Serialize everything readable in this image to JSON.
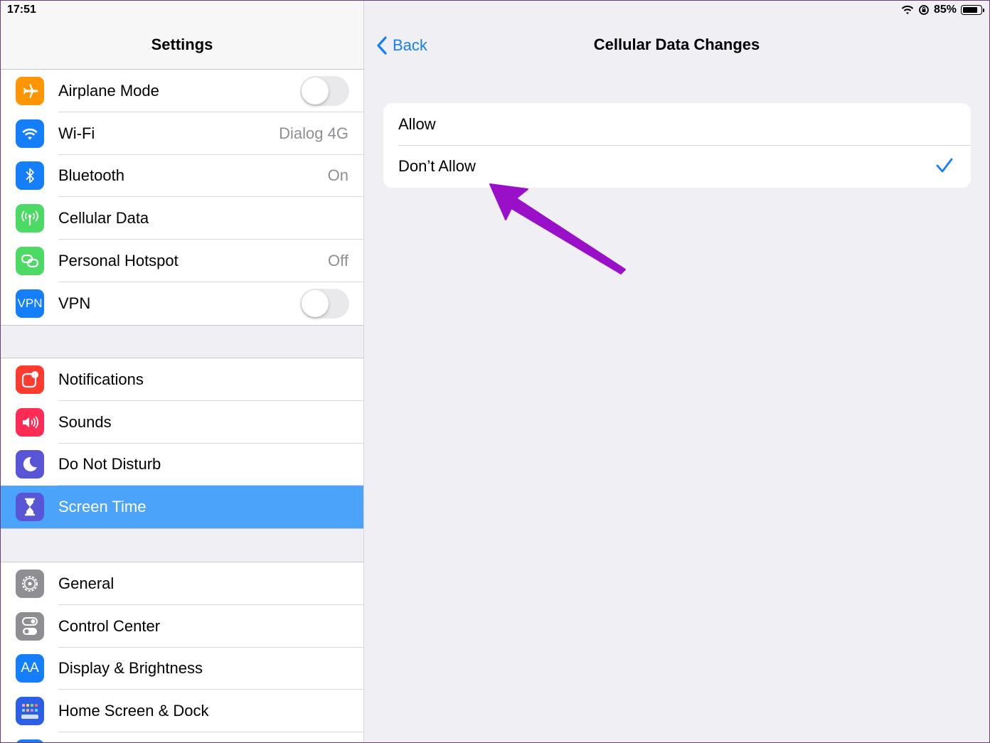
{
  "status_bar": {
    "time": "17:51",
    "battery": "85%",
    "battery_level": 0.85
  },
  "sidebar": {
    "title": "Settings",
    "groups": [
      [
        {
          "label": "Airplane Mode",
          "icon": "airplane-icon",
          "color": "#ff9500",
          "toggle": false
        },
        {
          "label": "Wi-Fi",
          "icon": "wifi-icon",
          "color": "#147efb",
          "value": "Dialog 4G"
        },
        {
          "label": "Bluetooth",
          "icon": "bluetooth-icon",
          "color": "#147efb",
          "value": "On"
        },
        {
          "label": "Cellular Data",
          "icon": "antenna-icon",
          "color": "#4cd964"
        },
        {
          "label": "Personal Hotspot",
          "icon": "hotspot-icon",
          "color": "#4cd964",
          "value": "Off"
        },
        {
          "label": "VPN",
          "icon": "vpn-icon",
          "icon_text": "VPN",
          "color": "#147efb",
          "toggle": false
        }
      ],
      [
        {
          "label": "Notifications",
          "icon": "notifications-icon",
          "color": "#ff3b30"
        },
        {
          "label": "Sounds",
          "icon": "speaker-icon",
          "color": "#ff2d55"
        },
        {
          "label": "Do Not Disturb",
          "icon": "moon-icon",
          "color": "#5856d6"
        },
        {
          "label": "Screen Time",
          "icon": "hourglass-icon",
          "color": "#5856d6",
          "selected": true
        }
      ],
      [
        {
          "label": "General",
          "icon": "gear-icon",
          "color": "#8e8e93"
        },
        {
          "label": "Control Center",
          "icon": "switches-icon",
          "color": "#8e8e93"
        },
        {
          "label": "Display & Brightness",
          "icon": "text-size-icon",
          "icon_text": "AA",
          "color": "#147efb"
        },
        {
          "label": "Home Screen & Dock",
          "icon": "grid-icon",
          "color": "#2c5fe6"
        }
      ]
    ]
  },
  "detail": {
    "back_label": "Back",
    "title": "Cellular Data Changes",
    "options": [
      {
        "label": "Allow",
        "checked": false
      },
      {
        "label": "Don’t Allow",
        "checked": true
      }
    ]
  },
  "colors": {
    "accent": "#147efb",
    "annotation_arrow": "#9a10c8",
    "selected_row": "#4ca3fa"
  }
}
